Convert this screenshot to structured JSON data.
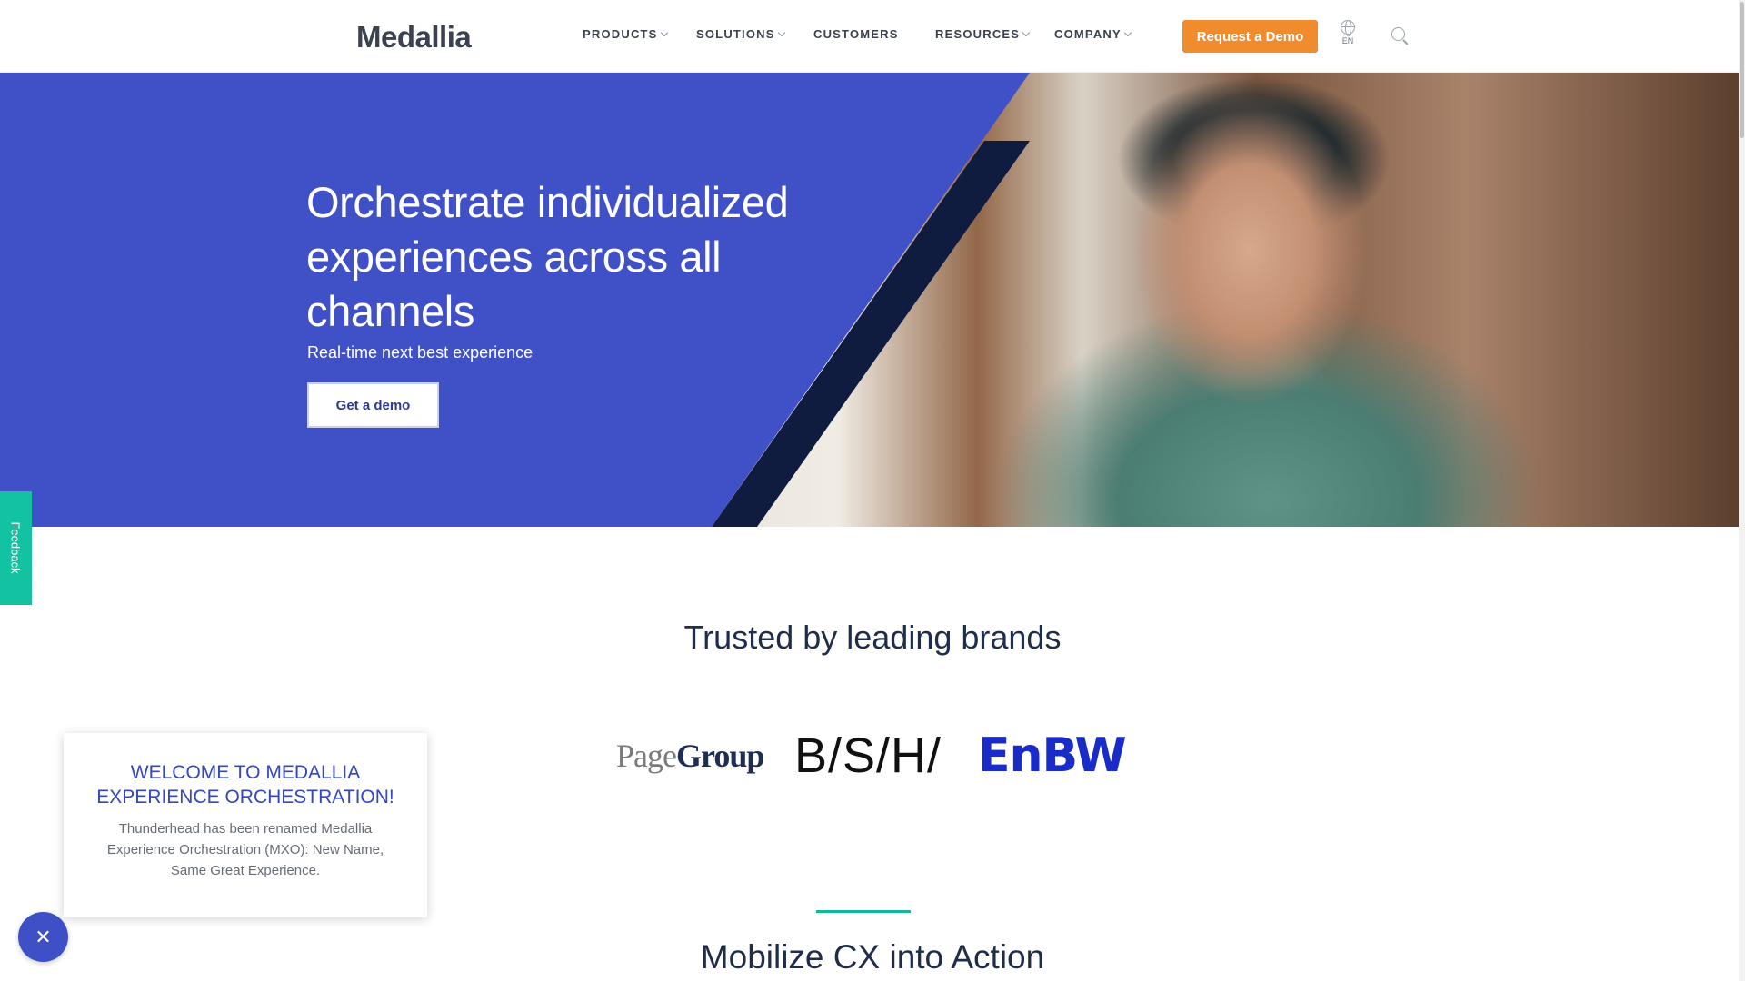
{
  "header": {
    "logo": "Medallia",
    "nav": [
      {
        "label": "PRODUCTS",
        "has_dropdown": true
      },
      {
        "label": "SOLUTIONS",
        "has_dropdown": true
      },
      {
        "label": "CUSTOMERS",
        "has_dropdown": false
      },
      {
        "label": "RESOURCES",
        "has_dropdown": true
      },
      {
        "label": "COMPANY",
        "has_dropdown": true
      }
    ],
    "cta_label": "Request a Demo",
    "language": "EN",
    "icons": {
      "language": "globe-icon",
      "search": "search-icon"
    },
    "cta_color": "#f08c2e"
  },
  "hero": {
    "title": "Orchestrate individualized experiences across all channels",
    "subtitle": "Real-time next best experience",
    "button_label": "Get a demo",
    "background_color": "#4051c7",
    "accent_stripe_color": "#0f1c40"
  },
  "feedback_tab": {
    "label": "Feedback",
    "color": "#13c2a0"
  },
  "trusted": {
    "heading": "Trusted by leading brands",
    "brands": [
      {
        "name": "PageGroup",
        "parts": [
          "Page",
          "Group"
        ]
      },
      {
        "name": "B/S/H/"
      },
      {
        "name": "EnBW",
        "display": "EnBW"
      }
    ]
  },
  "popup": {
    "title": "WELCOME TO MEDALLIA EXPERIENCE ORCHESTRATION!",
    "body": "Thunderhead has been renamed Medallia Experience Orchestration (MXO): New Name, Same Great Experience.",
    "close_icon": "close-icon",
    "close_glyph": "✕"
  },
  "section": {
    "heading": "Mobilize CX into Action",
    "divider_color": "#13b79a"
  }
}
